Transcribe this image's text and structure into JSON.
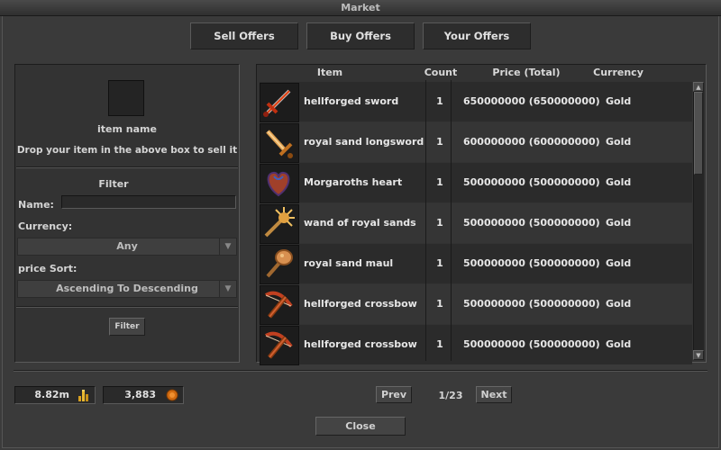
{
  "window": {
    "title": "Market"
  },
  "tabs": [
    "Sell Offers",
    "Buy Offers",
    "Your Offers"
  ],
  "sell_panel": {
    "item_name": "item name",
    "instruction": "Drop your item in the above box to sell it"
  },
  "filter": {
    "title": "Filter",
    "name_label": "Name:",
    "name_value": "",
    "currency_label": "Currency:",
    "currency_value": "Any",
    "sort_label": "price Sort:",
    "sort_value": "Ascending To Descending",
    "button_label": "Filter"
  },
  "table": {
    "columns": [
      "Item",
      "Count",
      "Price (Total)",
      "Currency"
    ],
    "rows": [
      {
        "icon": "sword-icon",
        "item": "hellforged sword",
        "count": "1",
        "price": "650000000 (650000000)",
        "currency": "Gold"
      },
      {
        "icon": "longsword-icon",
        "item": "royal sand longsword",
        "count": "1",
        "price": "600000000 (600000000)",
        "currency": "Gold"
      },
      {
        "icon": "heart-icon",
        "item": "Morgaroths heart",
        "count": "1",
        "price": "500000000 (500000000)",
        "currency": "Gold"
      },
      {
        "icon": "wand-icon",
        "item": "wand of royal sands",
        "count": "1",
        "price": "500000000 (500000000)",
        "currency": "Gold"
      },
      {
        "icon": "maul-icon",
        "item": "royal sand maul",
        "count": "1",
        "price": "500000000 (500000000)",
        "currency": "Gold"
      },
      {
        "icon": "crossbow-icon",
        "item": "hellforged crossbow",
        "count": "1",
        "price": "500000000 (500000000)",
        "currency": "Gold"
      },
      {
        "icon": "crossbow-icon",
        "item": "hellforged crossbow",
        "count": "1",
        "price": "500000000 (500000000)",
        "currency": "Gold"
      }
    ]
  },
  "footer": {
    "gold_amount": "8.82m",
    "coin_amount": "3,883",
    "prev_label": "Prev",
    "page_indicator": "1/23",
    "next_label": "Next",
    "close_label": "Close"
  },
  "colors": {
    "gold_icon": "#d8a020",
    "coin_icon": "#d06a10"
  }
}
